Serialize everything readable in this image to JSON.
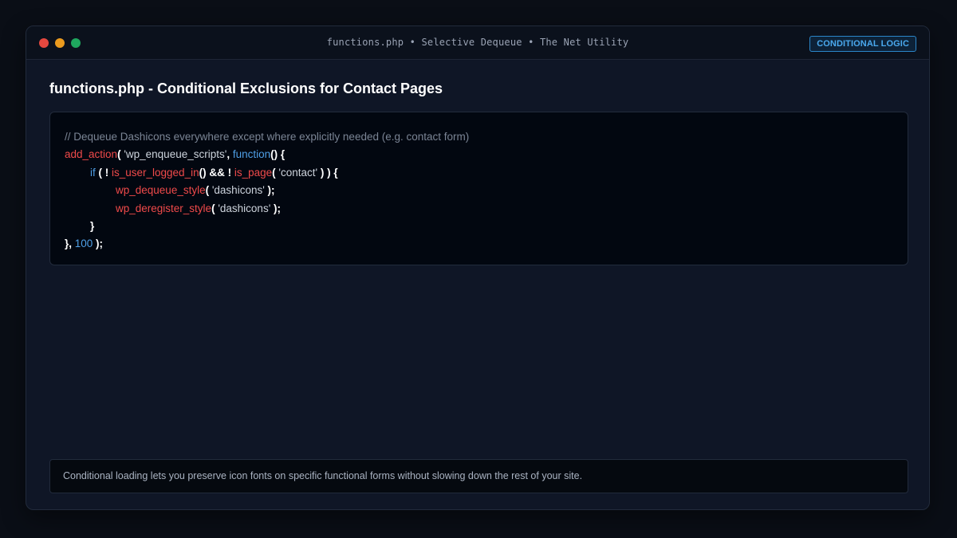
{
  "window": {
    "title": "functions.php • Selective Dequeue • The Net Utility",
    "badge": "CONDITIONAL LOGIC",
    "controls": [
      "close",
      "minimize",
      "maximize"
    ]
  },
  "page": {
    "title": "functions.php - Conditional Exclusions for Contact Pages"
  },
  "code": {
    "line1": {
      "comment": "// Dequeue Dashicons everywhere except where explicitly needed (e.g. contact form)"
    },
    "line2": {
      "fn": "add_action",
      "open": "( ",
      "str": "'wp_enqueue_scripts'",
      "comma": ", ",
      "kw": "function",
      "tail": "() {"
    },
    "line3": {
      "kw": "if",
      "p1": " ( ! ",
      "fn1": "is_user_logged_in",
      "p2": "() && ! ",
      "fn2": "is_page",
      "p3": "( ",
      "str": "'contact'",
      "p4": " ) ) {"
    },
    "line4": {
      "fn": "wp_dequeue_style",
      "open": "( ",
      "str": "'dashicons'",
      "close": " );"
    },
    "line5": {
      "fn": "wp_deregister_style",
      "open": "( ",
      "str": "'dashicons'",
      "close": " );"
    },
    "line6": {
      "brace": "}"
    },
    "line7": {
      "p1": "}, ",
      "num": "100",
      "p2": " );"
    }
  },
  "footer": {
    "note": "Conditional loading lets you preserve icon fonts on specific functional forms without slowing down the rest of your site."
  },
  "colors": {
    "close": "#e5483f",
    "minimize": "#eb9b1e",
    "maximize": "#1fa75e",
    "accent": "#4aa9ee",
    "function_name": "#f04a4a",
    "keyword": "#4f9fe6"
  }
}
